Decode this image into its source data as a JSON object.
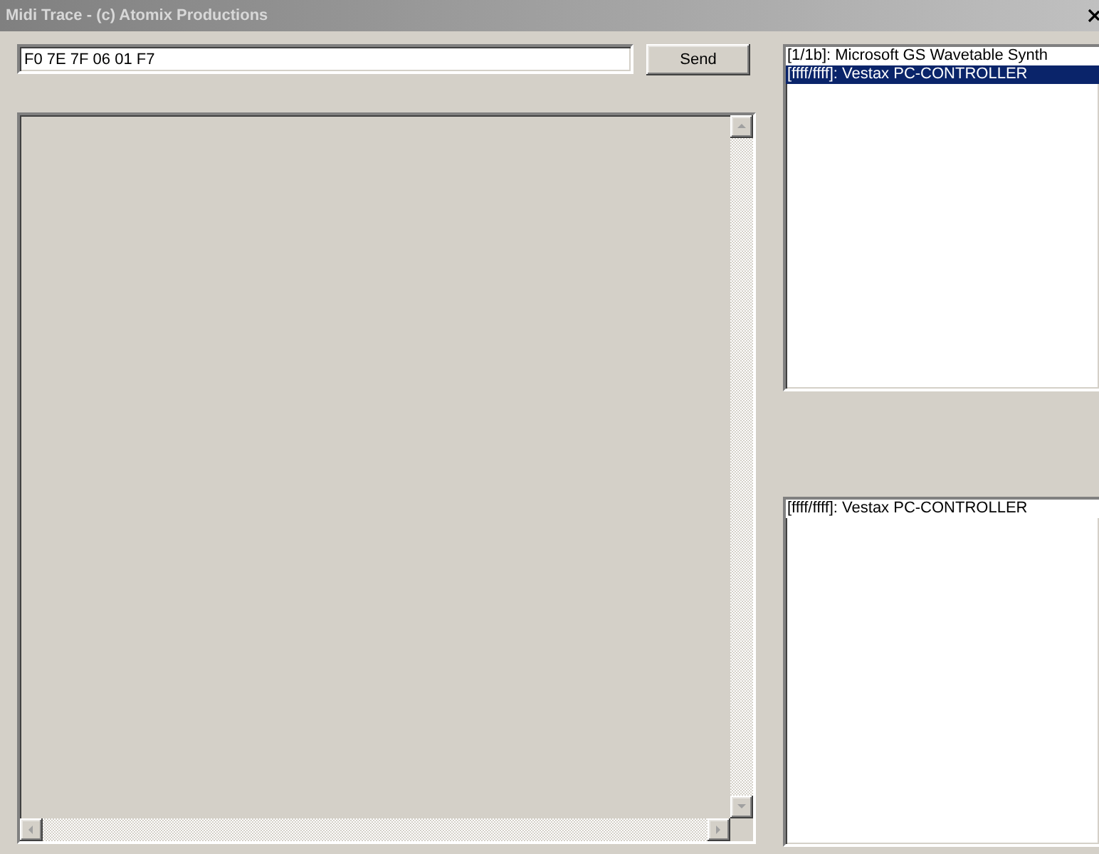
{
  "window": {
    "title": "Midi Trace - (c) Atomix Productions"
  },
  "message_field": {
    "value": "F0 7E 7F 06 01 F7"
  },
  "send_button": {
    "label": "Send"
  },
  "top_list": {
    "items": [
      {
        "label": "[1/1b]: Microsoft GS Wavetable Synth",
        "selected": false
      },
      {
        "label": "[ffff/ffff]: Vestax PC-CONTROLLER",
        "selected": true
      }
    ]
  },
  "bottom_list": {
    "items": [
      {
        "label": "[ffff/ffff]: Vestax PC-CONTROLLER",
        "selected": false
      }
    ]
  }
}
